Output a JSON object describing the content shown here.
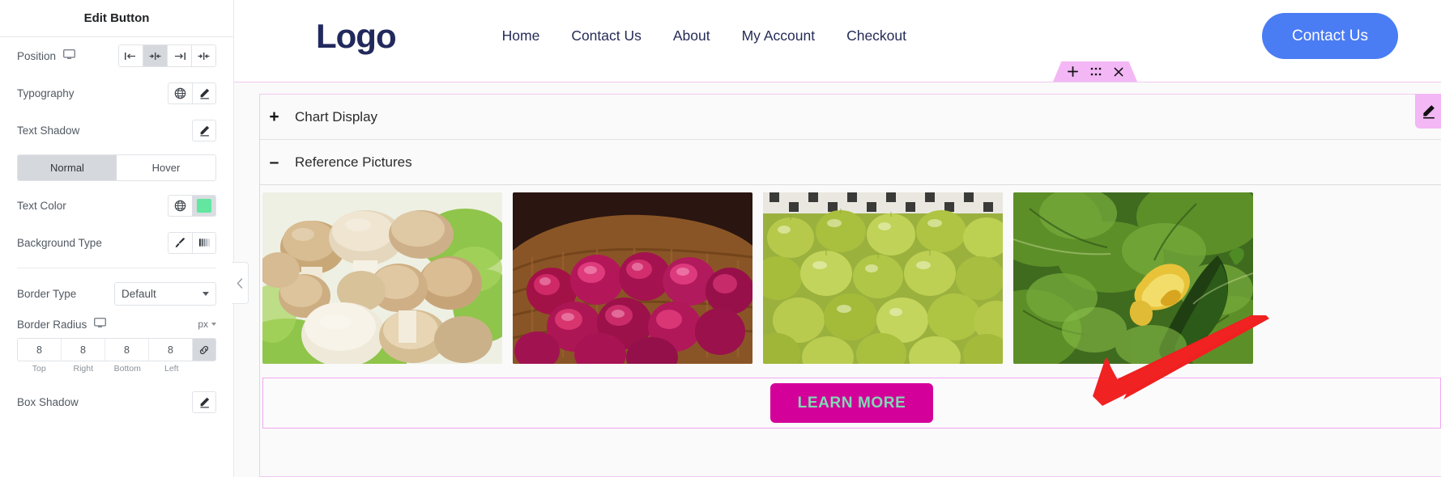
{
  "sidebar": {
    "panel_title": "Edit Button",
    "rows": {
      "position": {
        "label": "Position",
        "device_icon": "monitor-icon",
        "options": [
          "align-start",
          "align-center",
          "align-end",
          "align-justify"
        ],
        "selected_index": 1
      },
      "typography": {
        "label": "Typography",
        "global_icon": "globe-icon",
        "edit_icon": "pencil-icon"
      },
      "text_shadow": {
        "label": "Text Shadow",
        "edit_icon": "pencil-icon"
      },
      "state_tabs": {
        "items": [
          "Normal",
          "Hover"
        ],
        "selected_index": 0
      },
      "text_color": {
        "label": "Text Color",
        "global_icon": "globe-icon",
        "color": "#62e6a0"
      },
      "background_type": {
        "label": "Background Type",
        "classic_icon": "brush-icon",
        "gradient_icon": "gradient-icon"
      },
      "border_type": {
        "label": "Border Type",
        "value": "Default"
      },
      "border_radius": {
        "label": "Border Radius",
        "device_icon": "monitor-icon",
        "unit": "px",
        "values": [
          "8",
          "8",
          "8",
          "8"
        ],
        "sides": [
          "Top",
          "Right",
          "Bottom",
          "Left"
        ],
        "link_icon": "link-icon",
        "linked": true
      },
      "box_shadow": {
        "label": "Box Shadow",
        "edit_icon": "pencil-icon"
      }
    },
    "collapse_handle_icon": "chevron-left-icon"
  },
  "site_header": {
    "logo": "Logo",
    "nav": [
      "Home",
      "Contact Us",
      "About",
      "My Account",
      "Checkout"
    ],
    "cta_label": "Contact Us",
    "cta_color": "#4a7cf4",
    "logo_color": "#22295c"
  },
  "section_toolbar": {
    "add_icon": "plus-icon",
    "drag_icon": "grid-dots-icon",
    "close_icon": "close-icon",
    "tab_color": "#f3b7f5"
  },
  "editor": {
    "edit_badge_icon": "pencil-icon",
    "accordions": [
      {
        "symbol": "+",
        "label": "Chart Display",
        "state": "collapsed"
      },
      {
        "symbol": "–",
        "label": "Reference Pictures",
        "state": "expanded"
      }
    ],
    "pictures": [
      {
        "name": "mushrooms-photo",
        "alt": "White beech mushrooms on lettuce"
      },
      {
        "name": "red-onions-photo",
        "alt": "Red onions in wicker basket"
      },
      {
        "name": "green-olives-photo",
        "alt": "Green olives"
      },
      {
        "name": "zucchini-photo",
        "alt": "Zucchini plant with flower"
      }
    ],
    "cta": {
      "label": "LEARN MORE",
      "background": "#d4009a",
      "text_color": "#7fd9b4"
    },
    "annotation_arrow": {
      "name": "red-arrow-annotation",
      "color": "#f02020"
    }
  }
}
